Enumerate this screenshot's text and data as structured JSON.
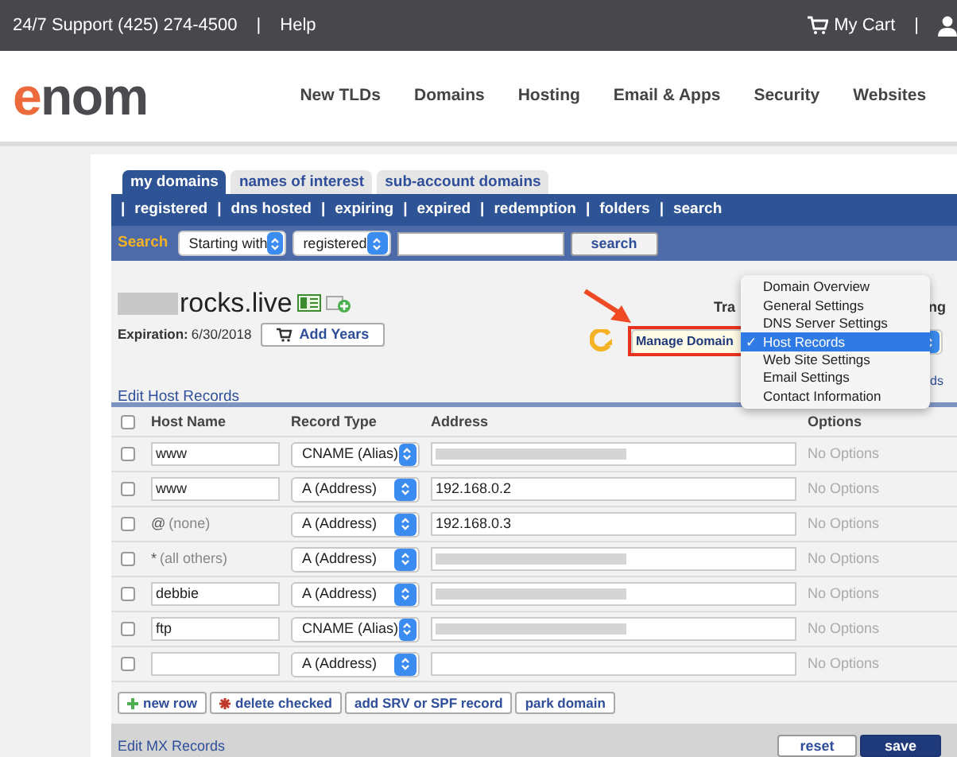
{
  "top_bar": {
    "support": "24/7 Support (425) 274-4500",
    "separator": "|",
    "help": "Help",
    "cart": "My Cart",
    "separator_2": "|"
  },
  "logo": {
    "accent": "e",
    "rest": "nom"
  },
  "nav": [
    "New TLDs",
    "Domains",
    "Hosting",
    "Email & Apps",
    "Security",
    "Websites"
  ],
  "tabs": [
    {
      "label": "my domains",
      "selected": true
    },
    {
      "label": "names of interest",
      "selected": false
    },
    {
      "label": "sub-account domains",
      "selected": false
    }
  ],
  "filter_separator": "|",
  "filters": [
    "registered",
    "dns hosted",
    "expiring",
    "expired",
    "redemption",
    "folders",
    "search"
  ],
  "search": {
    "label": "Search",
    "match": "Starting with",
    "scope": "registered",
    "button": "search"
  },
  "domain": {
    "redacted_prefix": true,
    "name": "rocks.live",
    "expiration_label": "Expiration:",
    "expiration": "6/30/2018",
    "add_years": "Add Years"
  },
  "manage": {
    "select": "Manage Domain",
    "hidden_texts": [
      "Tra",
      "ng",
      "ds"
    ]
  },
  "menu_check": "✓",
  "menu": [
    {
      "label": "Domain Overview",
      "selected": false
    },
    {
      "label": "General Settings",
      "selected": false
    },
    {
      "label": "DNS Server Settings",
      "selected": false
    },
    {
      "label": "Host Records",
      "selected": true
    },
    {
      "label": "Web Site Settings",
      "selected": false
    },
    {
      "label": "Email Settings",
      "selected": false
    },
    {
      "label": "Contact Information",
      "selected": false
    }
  ],
  "section_title": "Edit Host Records",
  "table": {
    "select_all_checked": false,
    "columns": [
      "Host Name",
      "Record Type",
      "Address",
      "Options"
    ],
    "rows": [
      {
        "checked": false,
        "kind": "field",
        "host": "www",
        "type": "CNAME (Alias)",
        "address": "",
        "address_redacted": true,
        "options": "No Options"
      },
      {
        "checked": false,
        "kind": "field",
        "host": "www",
        "type": "A (Address)",
        "address": "192.168.0.2",
        "address_redacted": false,
        "options": "No Options"
      },
      {
        "checked": false,
        "kind": "fixed",
        "host": "@",
        "note": "(none)",
        "type": "A (Address)",
        "address": "192.168.0.3",
        "address_redacted": false,
        "options": "No Options"
      },
      {
        "checked": false,
        "kind": "fixed",
        "host": "*",
        "note": "(all others)",
        "type": "A (Address)",
        "address": "",
        "address_redacted": true,
        "options": "No Options"
      },
      {
        "checked": false,
        "kind": "field",
        "host": "debbie",
        "type": "A (Address)",
        "address": "",
        "address_redacted": true,
        "options": "No Options"
      },
      {
        "checked": false,
        "kind": "field",
        "host": "ftp",
        "type": "CNAME (Alias)",
        "address": "",
        "address_redacted": true,
        "options": "No Options"
      },
      {
        "checked": false,
        "kind": "field",
        "host": "",
        "type": "A (Address)",
        "address": "",
        "address_redacted": false,
        "options": "No Options"
      }
    ]
  },
  "actions": [
    {
      "label": "new row",
      "kind": "add"
    },
    {
      "label": "delete checked",
      "kind": "delete"
    },
    {
      "label": "add SRV or SPF record",
      "kind": "plain"
    },
    {
      "label": "park domain",
      "kind": "plain"
    }
  ],
  "footer": {
    "link": "Edit MX Records",
    "buttons": [
      {
        "label": "reset",
        "primary": false
      },
      {
        "label": "save",
        "primary": true
      }
    ]
  }
}
